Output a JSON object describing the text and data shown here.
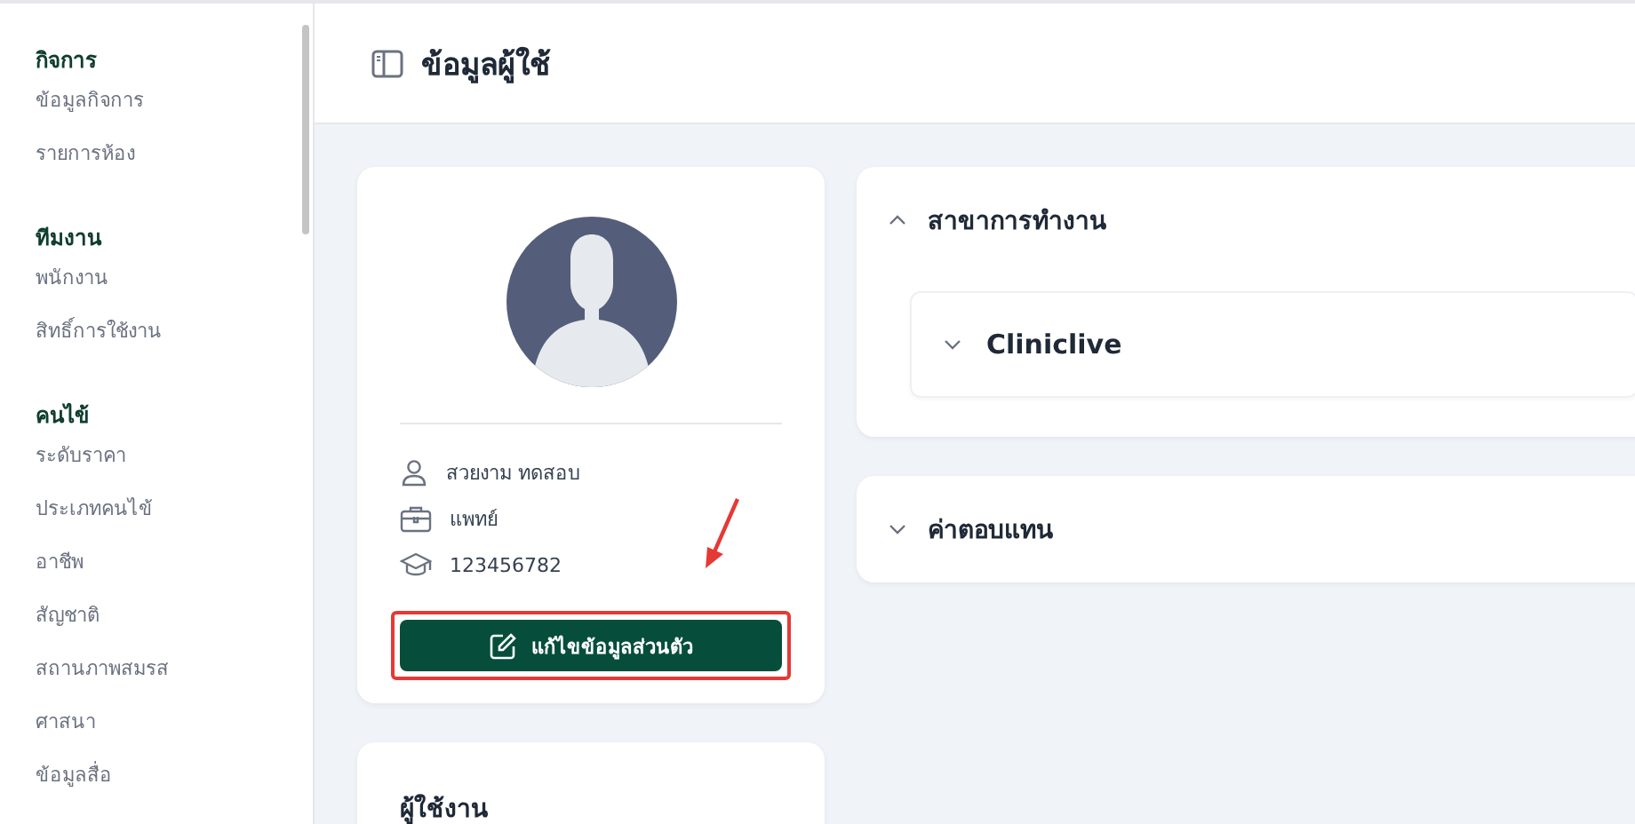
{
  "sidebar": {
    "sections": [
      {
        "title": "กิจการ",
        "items": [
          {
            "label": "ข้อมูลกิจการ"
          },
          {
            "label": "รายการห้อง"
          }
        ]
      },
      {
        "title": "ทีมงาน",
        "items": [
          {
            "label": "พนักงาน"
          },
          {
            "label": "สิทธิ์การใช้งาน"
          }
        ]
      },
      {
        "title": "คนไข้",
        "items": [
          {
            "label": "ระดับราคา"
          },
          {
            "label": "ประเภทคนไข้"
          },
          {
            "label": "อาชีพ"
          },
          {
            "label": "สัญชาติ"
          },
          {
            "label": "สถานภาพสมรส"
          },
          {
            "label": "ศาสนา"
          },
          {
            "label": "ข้อมูลสื่อ"
          }
        ]
      }
    ]
  },
  "header": {
    "title": "ข้อมูลผู้ใช้"
  },
  "profile": {
    "details": [
      {
        "kind": "person",
        "text": "สวยงาม ทดสอบ"
      },
      {
        "kind": "job",
        "text": "แพทย์"
      },
      {
        "kind": "license",
        "text": "123456782"
      }
    ],
    "button": "แก้ไขข้อมูลส่วนตัว"
  },
  "sections": [
    {
      "title": "สาขาการทำงาน",
      "expanded": true,
      "children": [
        {
          "title": "Cliniclive",
          "expanded": false
        }
      ]
    },
    {
      "title": "ค่าตอบแทน",
      "expanded": false
    }
  ],
  "users_card": {
    "title": "ผู้ใช้งาน"
  }
}
